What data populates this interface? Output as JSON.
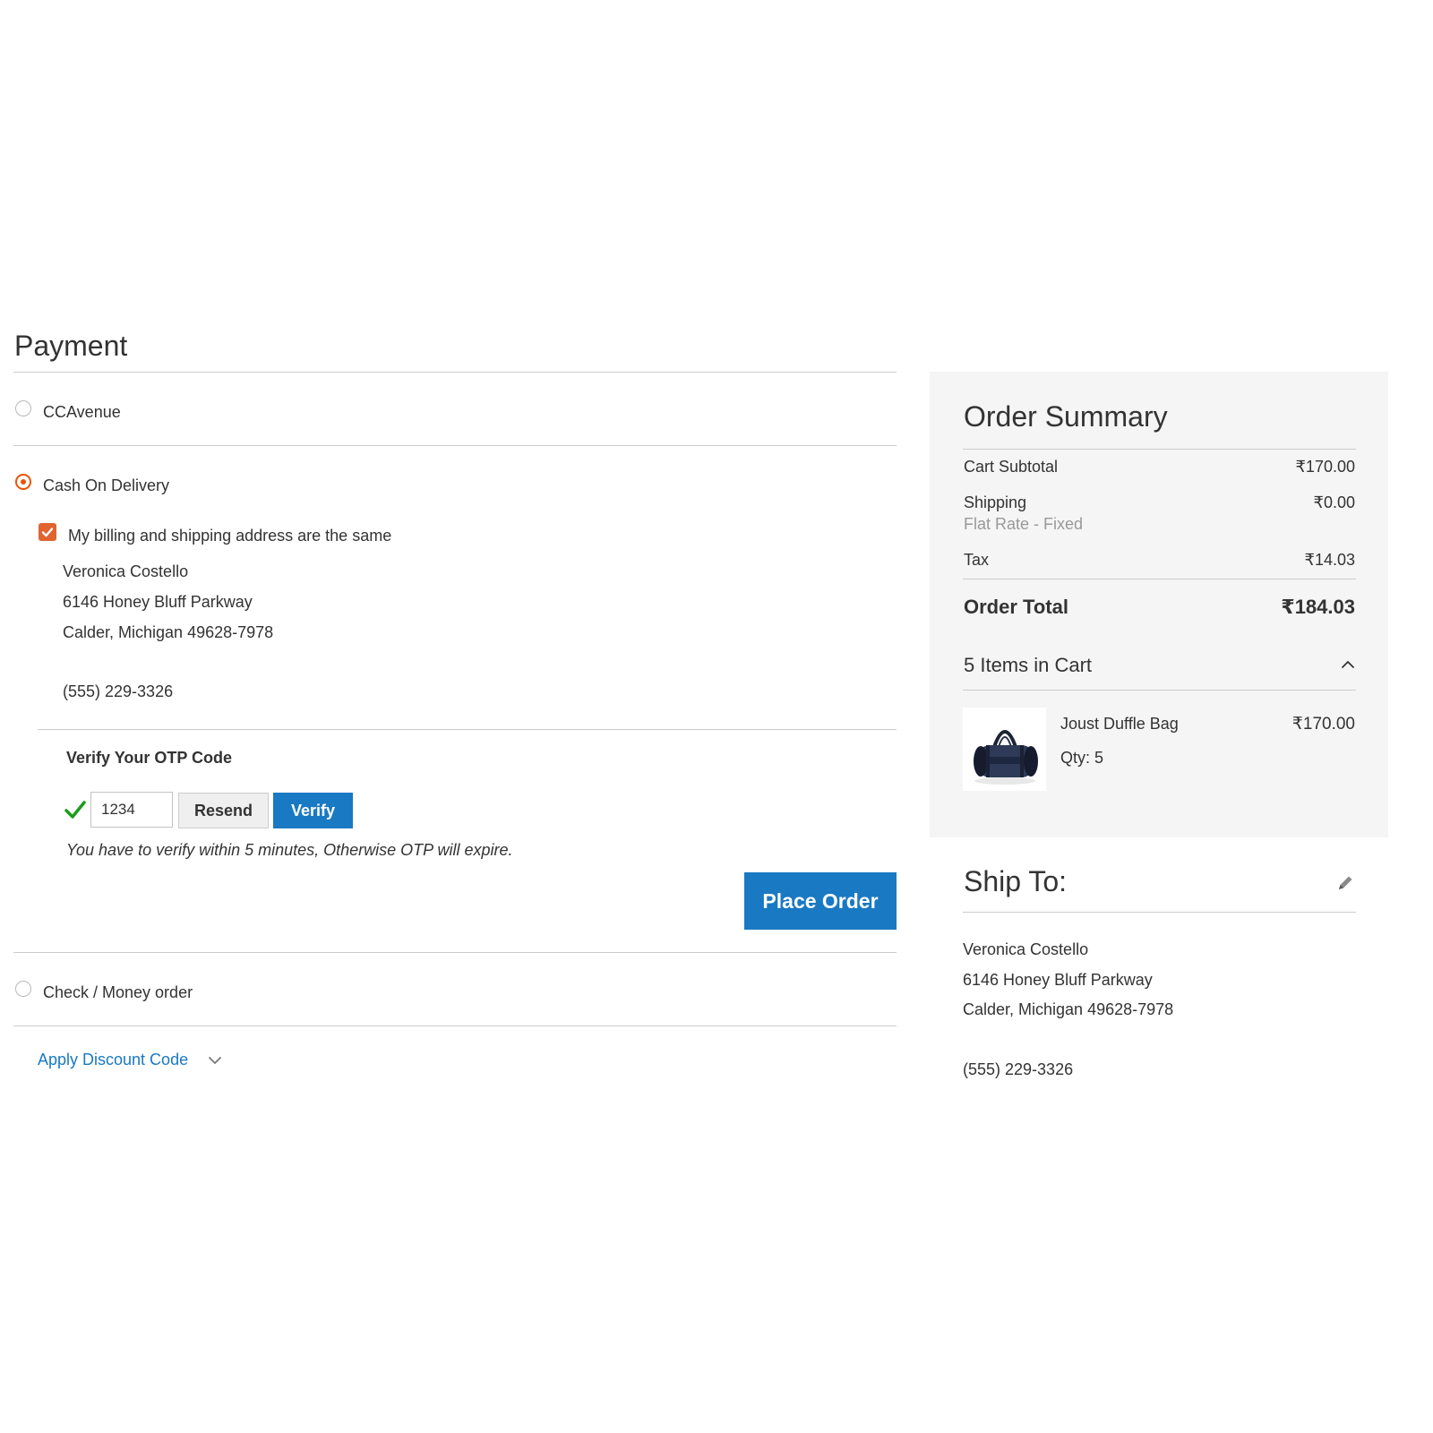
{
  "payment": {
    "title": "Payment",
    "methods": [
      {
        "label": "CCAvenue",
        "selected": false
      },
      {
        "label": "Cash On Delivery",
        "selected": true
      },
      {
        "label": "Check / Money order",
        "selected": false
      }
    ],
    "same_address_label": "My billing and shipping address are the same",
    "same_address_checked": true,
    "billing_address": {
      "name": "Veronica Costello",
      "street": "6146 Honey Bluff Parkway",
      "city_line": "Calder, Michigan 49628-7978",
      "phone": "(555) 229-3326"
    },
    "otp": {
      "title": "Verify Your OTP Code",
      "value": "1234",
      "resend_label": "Resend",
      "verify_label": "Verify",
      "note": "You have to verify within 5 minutes, Otherwise OTP will expire.",
      "verified_icon": "checkmark-icon"
    },
    "place_order_label": "Place Order",
    "discount_label": "Apply Discount Code"
  },
  "summary": {
    "title": "Order Summary",
    "cart_subtotal_label": "Cart Subtotal",
    "cart_subtotal_value": "₹170.00",
    "shipping_label": "Shipping",
    "shipping_method": "Flat Rate - Fixed",
    "shipping_value": "₹0.00",
    "tax_label": "Tax",
    "tax_value": "₹14.03",
    "order_total_label": "Order Total",
    "order_total_value": "₹184.03",
    "items_title": "5 Items in Cart",
    "items": [
      {
        "name": "Joust Duffle Bag",
        "qty": "Qty: 5",
        "price": "₹170.00"
      }
    ]
  },
  "ship_to": {
    "title": "Ship To:",
    "name": "Veronica Costello",
    "street": "6146 Honey Bluff Parkway",
    "city_line": "Calder, Michigan 49628-7978",
    "phone": "(555) 229-3326"
  },
  "colors": {
    "accent_blue": "#1979c3",
    "accent_orange": "#eb5202",
    "divider": "#cccccc",
    "panel_bg": "#f5f5f5"
  }
}
